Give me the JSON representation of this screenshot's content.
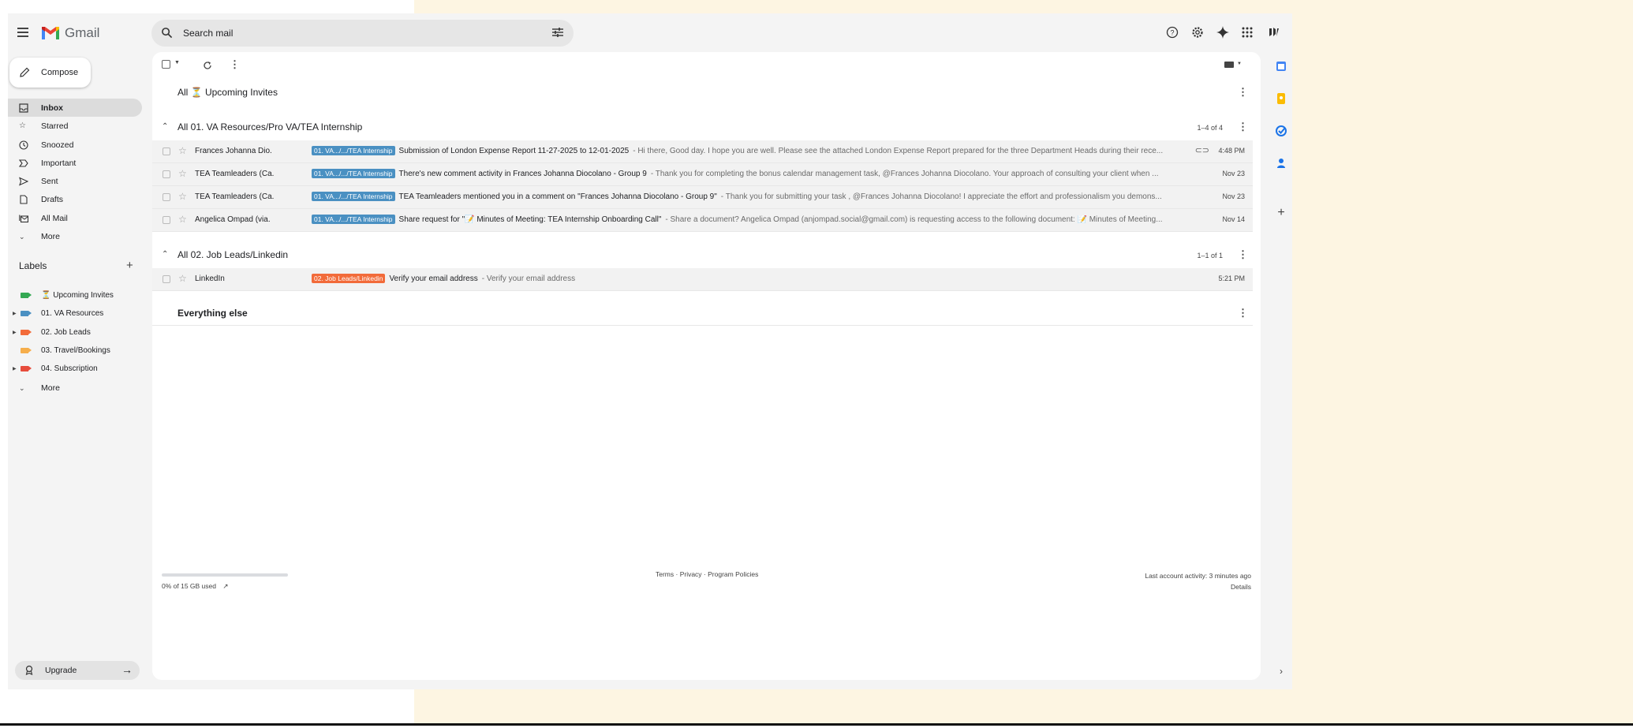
{
  "app": {
    "name": "Gmail"
  },
  "search": {
    "placeholder": "Search mail"
  },
  "compose_label": "Compose",
  "nav": [
    {
      "label": "Inbox",
      "icon": "inbox-icon",
      "active": true
    },
    {
      "label": "Starred",
      "icon": "star-icon"
    },
    {
      "label": "Snoozed",
      "icon": "clock-icon"
    },
    {
      "label": "Important",
      "icon": "important-icon"
    },
    {
      "label": "Sent",
      "icon": "send-icon"
    },
    {
      "label": "Drafts",
      "icon": "draft-icon"
    },
    {
      "label": "All Mail",
      "icon": "all-mail-icon"
    },
    {
      "label": "More",
      "icon": "chevron-down-icon"
    }
  ],
  "labels": {
    "title": "Labels",
    "items": [
      {
        "label": "⏳ Upcoming Invites",
        "color": "#34a853",
        "expandable": false
      },
      {
        "label": "01. VA Resources",
        "color": "#4a90c2",
        "expandable": true
      },
      {
        "label": "02. Job Leads",
        "color": "#f26b3a",
        "expandable": true
      },
      {
        "label": "03. Travel/Bookings",
        "color": "#f6ae4b",
        "expandable": false
      },
      {
        "label": "04. Subscription",
        "color": "#e74c3c",
        "expandable": true
      }
    ],
    "more": "More"
  },
  "upgrade_label": "Upgrade",
  "sections": {
    "upcoming": {
      "title": "All ⏳ Upcoming Invites"
    },
    "va": {
      "title": "All 01. VA Resources/Pro VA/TEA Internship",
      "count": "1–4 of 4"
    },
    "jobs": {
      "title": "All 02. Job Leads/Linkedin",
      "count": "1–1 of 1"
    },
    "else": {
      "title": "Everything else"
    }
  },
  "emails_va": [
    {
      "sender": "Frances Johanna Dio.",
      "chip": "01. VA.../.../TEA Internship",
      "subject": "Submission of London Expense Report 11-27-2025 to 12-01-2025",
      "snippet": "- Hi there, Good day. I hope you are well. Please see the attached London Expense Report prepared for the three Department Heads during their rece...",
      "date": "4:48 PM",
      "attachment": true
    },
    {
      "sender": "TEA Teamleaders (Ca.",
      "chip": "01. VA.../.../TEA Internship",
      "subject": "There's new comment activity in Frances Johanna Diocolano - Group 9",
      "snippet": "- Thank you for completing the bonus calendar management task, @Frances Johanna Diocolano. Your approach of consulting your client when ...",
      "date": "Nov 23",
      "attachment": false
    },
    {
      "sender": "TEA Teamleaders (Ca.",
      "chip": "01. VA.../.../TEA Internship",
      "subject": "TEA Teamleaders mentioned you in a comment on \"Frances Johanna Diocolano - Group 9\"",
      "snippet": "- Thank you for submitting your task , @Frances Johanna Diocolano! I appreciate the effort and professionalism you demons...",
      "date": "Nov 23",
      "attachment": false
    },
    {
      "sender": "Angelica Ompad (via.",
      "chip": "01. VA.../.../TEA Internship",
      "subject": "Share request for \"📝 Minutes of Meeting: TEA Internship Onboarding Call\"",
      "snippet": "- Share a document? Angelica Ompad (anjompad.social@gmail.com) is requesting access to the following document: 📝 Minutes of Meeting...",
      "date": "Nov 14",
      "attachment": false
    }
  ],
  "emails_jobs": [
    {
      "sender": "LinkedIn",
      "chip": "02. Job Leads/Linkedin",
      "subject": "Verify your email address",
      "snippet": "- Verify your email address",
      "date": "5:21 PM"
    }
  ],
  "colors": {
    "va_chip": "#4a90c2",
    "jobs_chip": "#f26b3a"
  },
  "footer": {
    "storage": "0% of 15 GB used",
    "links": "Terms · Privacy · Program Policies",
    "activity": "Last account activity: 3 minutes ago",
    "details": "Details"
  }
}
